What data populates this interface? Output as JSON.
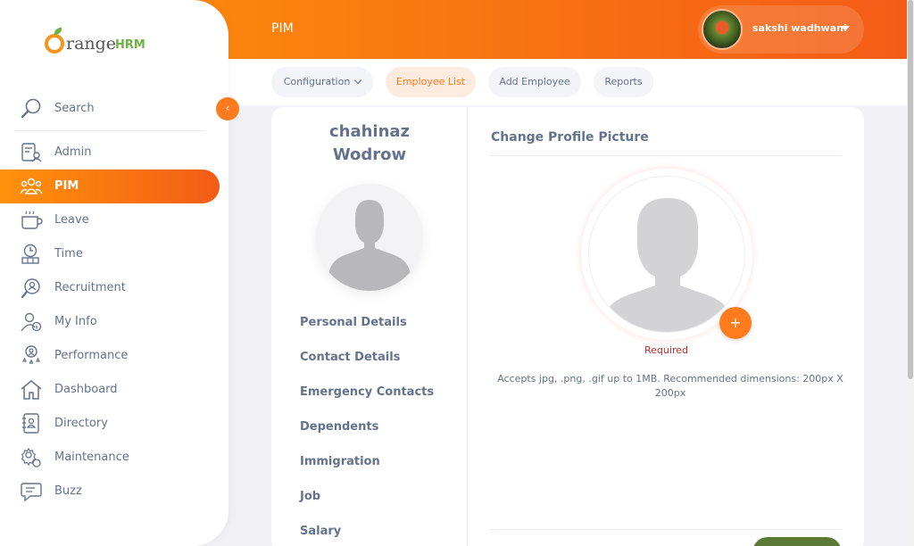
{
  "header": {
    "module_title": "PIM",
    "user_name": "sakshi wadhwani"
  },
  "subnav": {
    "tabs": [
      {
        "label": "Configuration",
        "has_dropdown": true
      },
      {
        "label": "Employee List",
        "active": true
      },
      {
        "label": "Add Employee"
      },
      {
        "label": "Reports"
      }
    ]
  },
  "sidebar": {
    "logo_word": "range",
    "logo_suffix": "HRM",
    "search_label": "Search",
    "collapse_icon": "‹",
    "items": [
      {
        "label": "Admin",
        "icon": "admin-icon"
      },
      {
        "label": "PIM",
        "icon": "pim-icon",
        "active": true
      },
      {
        "label": "Leave",
        "icon": "leave-icon"
      },
      {
        "label": "Time",
        "icon": "time-icon"
      },
      {
        "label": "Recruitment",
        "icon": "recruitment-icon"
      },
      {
        "label": "My Info",
        "icon": "my-info-icon"
      },
      {
        "label": "Performance",
        "icon": "performance-icon"
      },
      {
        "label": "Dashboard",
        "icon": "dashboard-icon"
      },
      {
        "label": "Directory",
        "icon": "directory-icon"
      },
      {
        "label": "Maintenance",
        "icon": "maintenance-icon"
      },
      {
        "label": "Buzz",
        "icon": "buzz-icon"
      }
    ]
  },
  "employee": {
    "first_name": "chahinaz",
    "last_name": "Wodrow"
  },
  "profile_tabs": [
    "Personal Details",
    "Contact Details",
    "Emergency Contacts",
    "Dependents",
    "Immigration",
    "Job",
    "Salary"
  ],
  "picture_panel": {
    "title": "Change Profile Picture",
    "add_icon": "+",
    "required_text": "Required",
    "hint": "Accepts jpg, .png, .gif up to 1MB. Recommended dimensions: 200px X 200px"
  },
  "colors": {
    "accent": "#ff7b1d",
    "header_start": "#ff920b",
    "header_end": "#f35c17",
    "text": "#64728c",
    "error": "#c02a2a",
    "save": "#5c7a35"
  }
}
